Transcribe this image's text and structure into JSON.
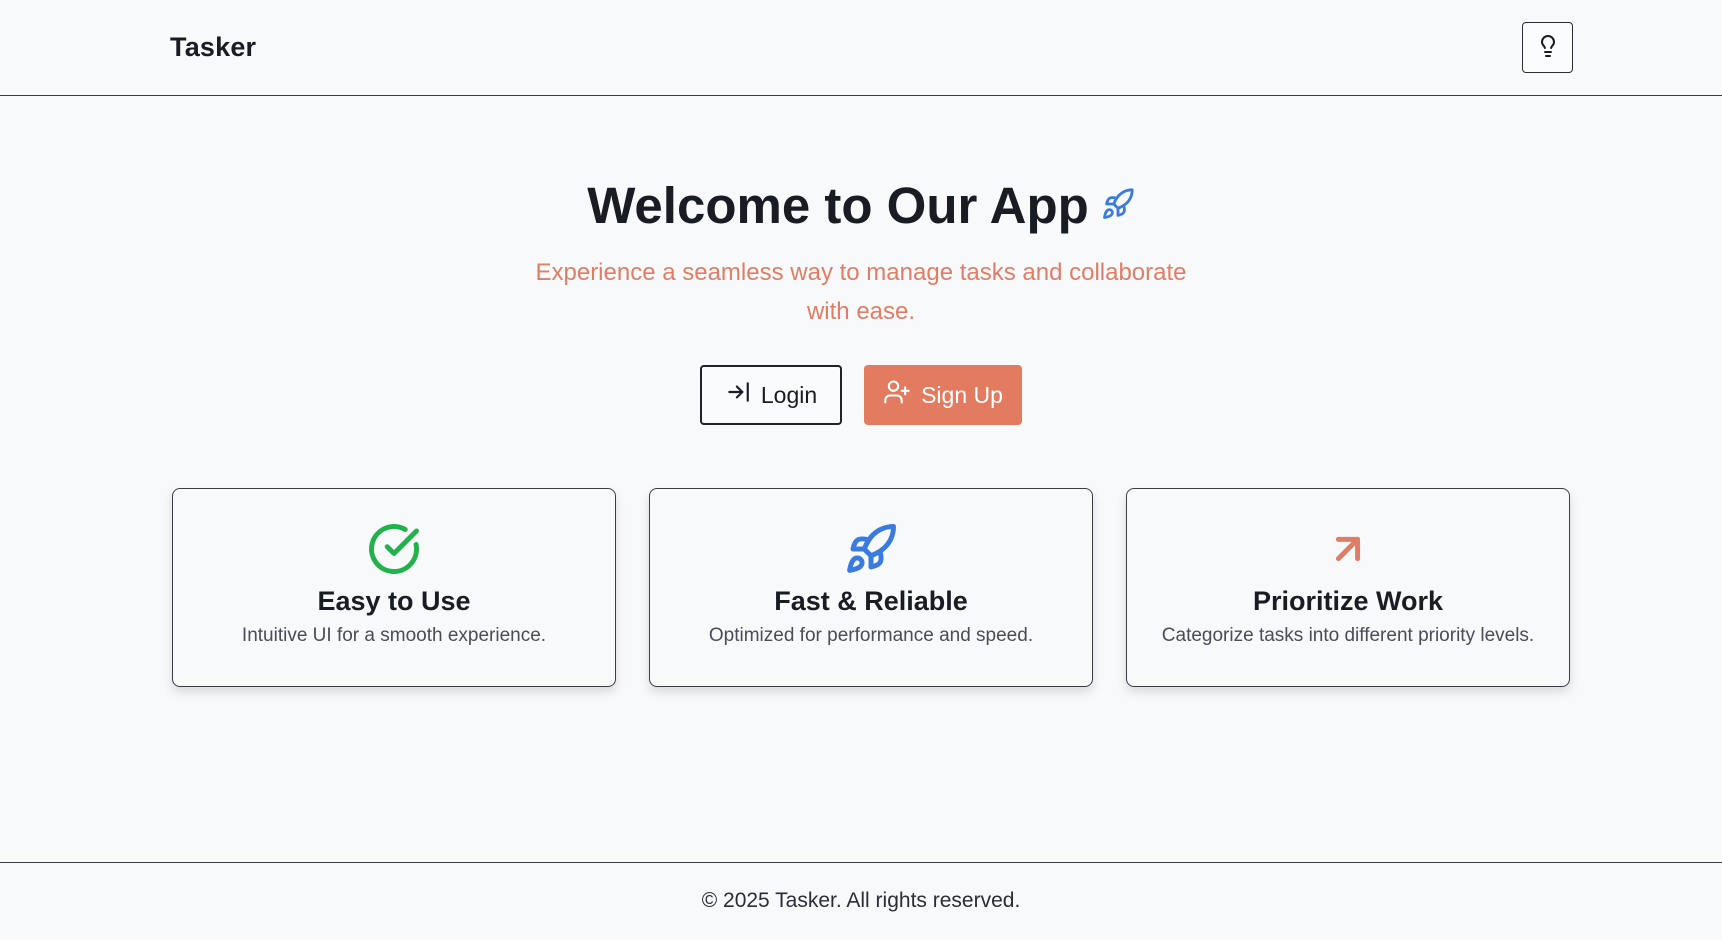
{
  "app": {
    "brand": "Tasker"
  },
  "header": {
    "theme_toggle_icon": "lightbulb-icon"
  },
  "hero": {
    "title": "Welcome to Our App",
    "title_icon": "rocket-icon",
    "subtitle": "Experience a seamless way to manage tasks and collaborate with ease.",
    "login_label": "Login",
    "login_icon": "log-in-icon",
    "signup_label": "Sign Up",
    "signup_icon": "user-plus-icon"
  },
  "features": [
    {
      "icon": "check-circle-icon",
      "title": "Easy to Use",
      "description": "Intuitive UI for a smooth experience."
    },
    {
      "icon": "rocket-icon",
      "title": "Fast & Reliable",
      "description": "Optimized for performance and speed."
    },
    {
      "icon": "arrow-up-right-icon",
      "title": "Prioritize Work",
      "description": "Categorize tasks into different priority levels."
    }
  ],
  "footer": {
    "text": "© 2025 Tasker. All rights reserved."
  },
  "colors": {
    "accent": "#e27b5f",
    "subtitle": "#e07d65",
    "rocket": "#3b7be0",
    "check": "#22b24c",
    "arrow": "#e07d65",
    "text": "#1a1c24",
    "background": "#f8f9fb"
  }
}
